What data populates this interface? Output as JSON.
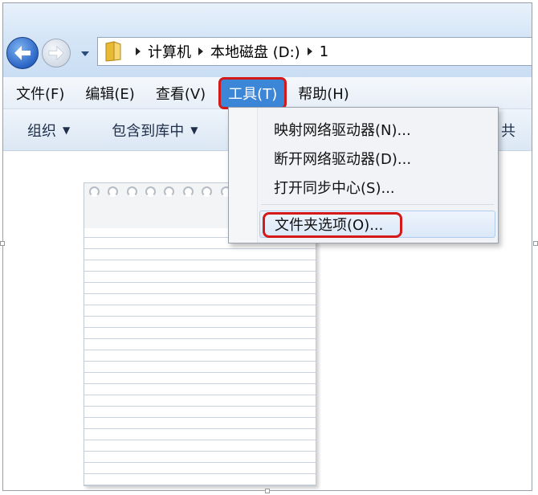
{
  "address_bar": {
    "crumbs": [
      "计算机",
      "本地磁盘 (D:)",
      "1"
    ]
  },
  "menu_bar": {
    "items": [
      "文件(F)",
      "编辑(E)",
      "查看(V)",
      "工具(T)",
      "帮助(H)"
    ]
  },
  "toolbar": {
    "organize": "组织",
    "include_in_library": "包含到库中",
    "truncated_right": "共"
  },
  "tools_menu": {
    "items": [
      "映射网络驱动器(N)...",
      "断开网络驱动器(D)...",
      "打开同步中心(S)...",
      "文件夹选项(O)..."
    ]
  },
  "colors": {
    "highlight_red": "#d41919",
    "active_menu_blue": "#3c86d8"
  }
}
